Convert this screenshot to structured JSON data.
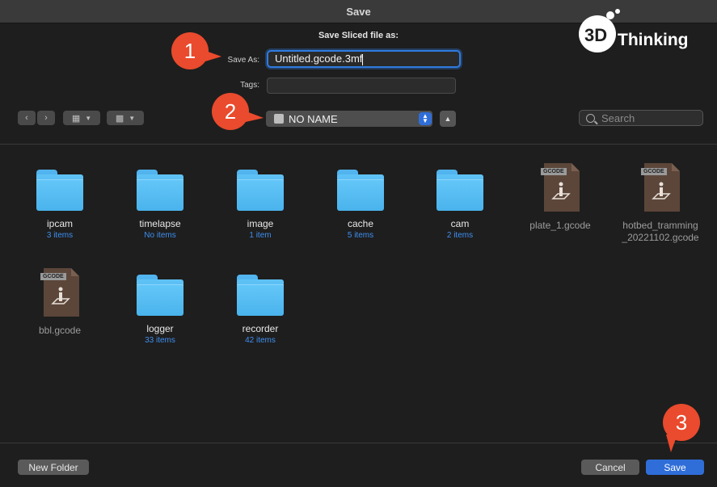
{
  "window": {
    "title": "Save"
  },
  "dialog": {
    "heading": "Save Sliced file as:",
    "save_as_label": "Save As:",
    "save_as_value": "Untitled.gcode.3mf",
    "tags_label": "Tags:"
  },
  "toolbar": {
    "location": "NO NAME",
    "search_placeholder": "Search"
  },
  "items": [
    {
      "name": "ipcam",
      "count": "3 items",
      "type": "folder"
    },
    {
      "name": "timelapse",
      "count": "No items",
      "type": "folder"
    },
    {
      "name": "image",
      "count": "1 item",
      "type": "folder"
    },
    {
      "name": "cache",
      "count": "5 items",
      "type": "folder"
    },
    {
      "name": "cam",
      "count": "2 items",
      "type": "folder"
    },
    {
      "name": "plate_1.gcode",
      "type": "file",
      "badge": "GCODE"
    },
    {
      "name_line1": "hotbed_tramming",
      "name_line2": "_20221102.gcode",
      "type": "file",
      "badge": "GCODE"
    },
    {
      "name": "bbl.gcode",
      "type": "file",
      "badge": "GCODE"
    },
    {
      "name": "logger",
      "count": "33 items",
      "type": "folder"
    },
    {
      "name": "recorder",
      "count": "42 items",
      "type": "folder"
    }
  ],
  "footer": {
    "new_folder": "New Folder",
    "cancel": "Cancel",
    "save": "Save"
  },
  "annotations": [
    "1",
    "2",
    "3"
  ],
  "logo": {
    "text": "Thinking",
    "mark": "3D"
  },
  "colors": {
    "accent": "#2f6ed8",
    "folder": "#52b4ee",
    "badge": "#ea4a2d",
    "count_text": "#3e8ff0"
  }
}
